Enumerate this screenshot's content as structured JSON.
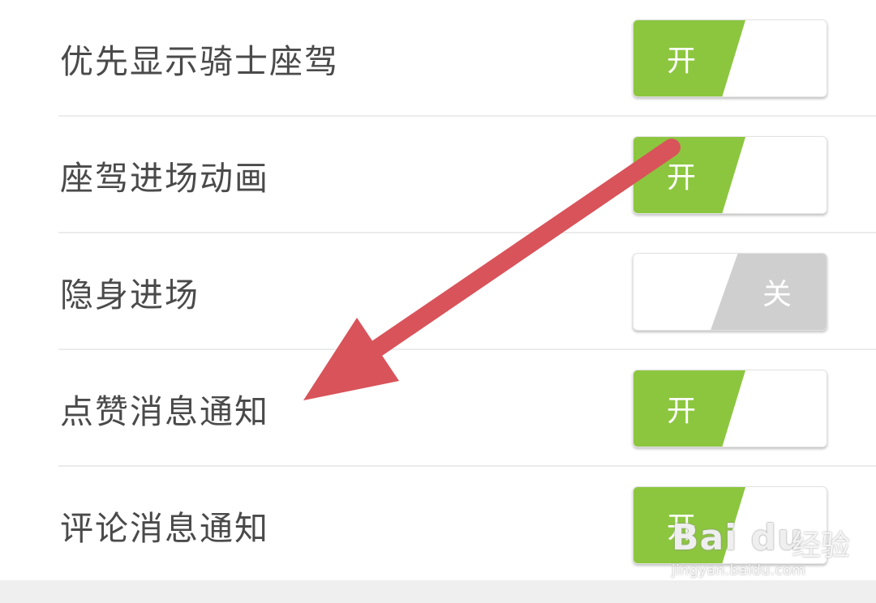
{
  "settings": {
    "items": [
      {
        "label": "优先显示骑士座驾",
        "state": "on",
        "toggle_text": "开"
      },
      {
        "label": "座驾进场动画",
        "state": "on",
        "toggle_text": "开"
      },
      {
        "label": "隐身进场",
        "state": "off",
        "toggle_text": "关"
      },
      {
        "label": "点赞消息通知",
        "state": "on",
        "toggle_text": "开"
      },
      {
        "label": "评论消息通知",
        "state": "on",
        "toggle_text": "开"
      }
    ]
  },
  "colors": {
    "toggle_on": "#8cc63f",
    "toggle_off": "#cfcfcf",
    "label_text": "#4a4a4a",
    "arrow": "#d9535a"
  },
  "watermark": {
    "brand": "Bai du",
    "brand_cn": "经验",
    "url": "jingyan.baidu.com"
  }
}
